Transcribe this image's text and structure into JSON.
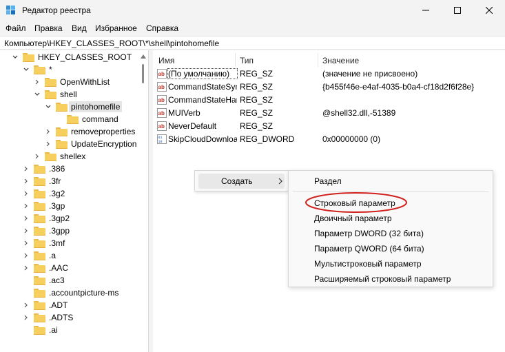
{
  "window": {
    "title": "Редактор реестра"
  },
  "menubar": {
    "items": [
      "Файл",
      "Правка",
      "Вид",
      "Избранное",
      "Справка"
    ]
  },
  "address": {
    "path": "Компьютер\\HKEY_CLASSES_ROOT\\*\\shell\\pintohomefile"
  },
  "tree": {
    "items": [
      {
        "label": "HKEY_CLASSES_ROOT",
        "state": "expanded"
      },
      {
        "label": "*",
        "state": "expanded"
      },
      {
        "label": "OpenWithList",
        "state": "collapsed"
      },
      {
        "label": "shell",
        "state": "expanded"
      },
      {
        "label": "pintohomefile",
        "state": "expanded",
        "selected": true
      },
      {
        "label": "command",
        "state": "leaf"
      },
      {
        "label": "removeproperties",
        "state": "collapsed"
      },
      {
        "label": "UpdateEncryption",
        "state": "collapsed"
      },
      {
        "label": "shellex",
        "state": "collapsed"
      },
      {
        "label": ".386",
        "state": "collapsed"
      },
      {
        "label": ".3fr",
        "state": "collapsed"
      },
      {
        "label": ".3g2",
        "state": "collapsed"
      },
      {
        "label": ".3gp",
        "state": "collapsed"
      },
      {
        "label": ".3gp2",
        "state": "collapsed"
      },
      {
        "label": ".3gpp",
        "state": "collapsed"
      },
      {
        "label": ".3mf",
        "state": "collapsed"
      },
      {
        "label": ".a",
        "state": "collapsed"
      },
      {
        "label": ".AAC",
        "state": "collapsed"
      },
      {
        "label": ".ac3",
        "state": "leaf"
      },
      {
        "label": ".accountpicture-ms",
        "state": "leaf"
      },
      {
        "label": ".ADT",
        "state": "collapsed"
      },
      {
        "label": ".ADTS",
        "state": "collapsed"
      },
      {
        "label": ".ai",
        "state": "leaf"
      }
    ]
  },
  "list": {
    "headers": {
      "name": "Имя",
      "type": "Тип",
      "value": "Значение"
    },
    "rows": [
      {
        "name": "(По умолчанию)",
        "type": "REG_SZ",
        "value": "(значение не присвоено)",
        "icon": "string-value-icon"
      },
      {
        "name": "CommandStateSync",
        "type": "REG_SZ",
        "value": "{b455f46e-e4af-4035-b0a4-cf18d2f6f28e}",
        "icon": "string-value-icon"
      },
      {
        "name": "CommandStateHandler",
        "type": "REG_SZ",
        "value": "",
        "icon": "string-value-icon"
      },
      {
        "name": "MUIVerb",
        "type": "REG_SZ",
        "value": "@shell32.dll,-51389",
        "icon": "string-value-icon"
      },
      {
        "name": "NeverDefault",
        "type": "REG_SZ",
        "value": "",
        "icon": "string-value-icon"
      },
      {
        "name": "SkipCloudDownload",
        "type": "REG_DWORD",
        "value": "0x00000000 (0)",
        "icon": "dword-value-icon"
      }
    ]
  },
  "context_menu": {
    "create_label": "Создать"
  },
  "submenu": {
    "items": [
      "Раздел",
      "Строковый параметр",
      "Двоичный параметр",
      "Параметр DWORD (32 бита)",
      "Параметр QWORD (64 бита)",
      "Мультистроковый параметр",
      "Расширяемый строковый параметр"
    ]
  },
  "colors": {
    "highlight_ellipse": "#d0211c",
    "folder": "#f7cf5e"
  }
}
